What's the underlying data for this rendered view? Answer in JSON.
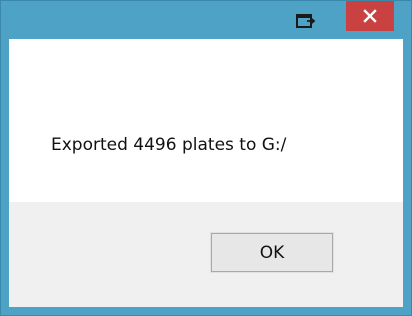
{
  "dialog": {
    "message": "Exported 4496 plates to G:/",
    "ok_label": "OK"
  },
  "titlebar": {
    "icons": {
      "pin": "window-pin-icon",
      "close": "close-icon"
    },
    "colors": {
      "frame": "#4ea2c5",
      "close_bg": "#c94141"
    }
  }
}
